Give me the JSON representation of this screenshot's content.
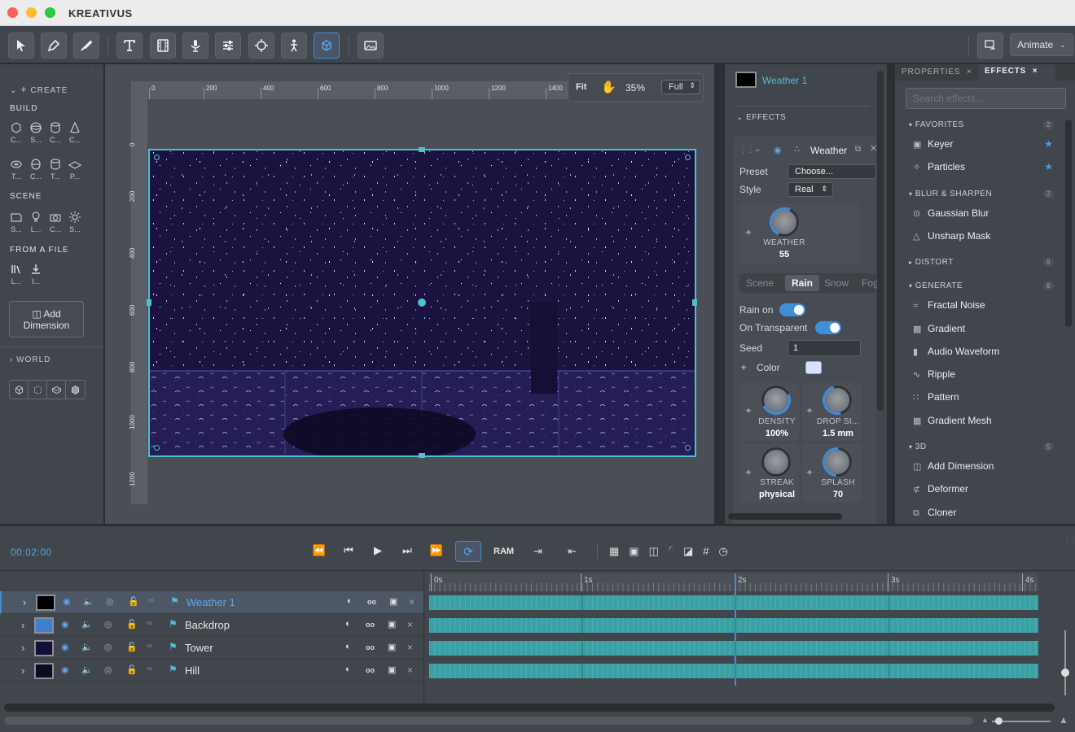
{
  "app": {
    "title": "KREATIVUS"
  },
  "toolbar": {
    "animate_label": "Animate"
  },
  "left": {
    "create": "CREATE",
    "build": "BUILD",
    "build_items": [
      "C...",
      "S...",
      "C...",
      "C...",
      "T...",
      "C...",
      "T...",
      "P..."
    ],
    "scene": "SCENE",
    "scene_items": [
      "S...",
      "L...",
      "C...",
      "S..."
    ],
    "from_file": "FROM A FILE",
    "file_items": [
      "L...",
      "I..."
    ],
    "add_line1": "Add",
    "add_line2": "Dimension",
    "world": "WORLD"
  },
  "rulers": {
    "top": [
      "0",
      "200",
      "400",
      "600",
      "800",
      "1000",
      "1200",
      "1400"
    ],
    "left": [
      "0",
      "200",
      "400",
      "600",
      "800",
      "1000",
      "1200"
    ]
  },
  "viewport": {
    "fit": "Fit",
    "zoom": "35%",
    "quality": "Full"
  },
  "mid": {
    "layer_name": "Weather 1",
    "effects": "EFFECTS",
    "effect_name": "Weather",
    "preset_label": "Preset",
    "preset_value": "Choose...",
    "style_label": "Style",
    "style_value": "Real",
    "weather_knob": {
      "label": "WEATHER",
      "value": "55"
    },
    "tabs": [
      "Scene",
      "Rain",
      "Snow",
      "Fog"
    ],
    "rain_on": "Rain on",
    "on_transparent": "On Transparent",
    "seed_label": "Seed",
    "seed_value": "1",
    "color_label": "Color",
    "color_value": "#d6e2ff",
    "knobs": [
      {
        "label": "DENSITY",
        "value": "100%"
      },
      {
        "label": "DROP SI...",
        "value": "1.5 mm"
      },
      {
        "label": "STREAK",
        "value": "physical"
      },
      {
        "label": "SPLASH",
        "value": "70"
      }
    ]
  },
  "right": {
    "tab_properties": "PROPERTIES",
    "tab_effects": "EFFECTS",
    "search_placeholder": "Search effects...",
    "groups": [
      {
        "name": "FAVORITES",
        "count": "2",
        "items": [
          "Keyer",
          "Particles"
        ]
      },
      {
        "name": "BLUR & SHARPEN",
        "count": "2",
        "items": [
          "Gaussian Blur",
          "Unsharp Mask"
        ]
      },
      {
        "name": "DISTORT",
        "count": "9",
        "items": []
      },
      {
        "name": "GENERATE",
        "count": "6",
        "items": [
          "Fractal Noise",
          "Gradient",
          "Audio Waveform",
          "Ripple",
          "Pattern",
          "Gradient Mesh"
        ]
      },
      {
        "name": "3D",
        "count": "5",
        "items": [
          "Add Dimension",
          "Deformer",
          "Cloner"
        ]
      }
    ]
  },
  "timeline": {
    "timecode": "00:02:00",
    "ram": "RAM",
    "ticks": [
      "0s",
      "1s",
      "2s",
      "3s",
      "4s"
    ],
    "layers": [
      {
        "name": "Weather 1",
        "swatch": "#000000",
        "selected": true
      },
      {
        "name": "Backdrop",
        "swatch": "#3f7fd0",
        "selected": false
      },
      {
        "name": "Tower",
        "swatch": "#150f35",
        "selected": false
      },
      {
        "name": "Hill",
        "swatch": "#0d0a24",
        "selected": false
      }
    ],
    "col_label": "oo"
  }
}
